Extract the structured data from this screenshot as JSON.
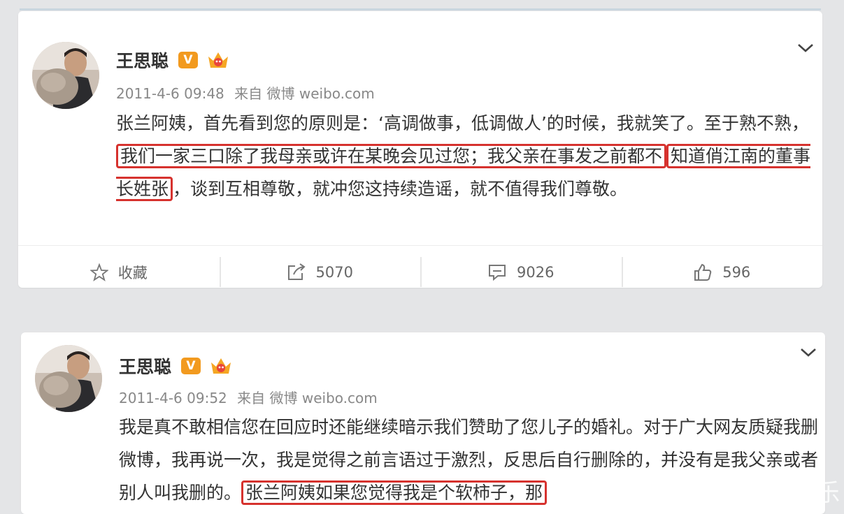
{
  "posts": [
    {
      "name": "王思聪",
      "v_badge": "V",
      "time": "2011-4-6 09:48",
      "source": "来自 微博 weibo.com",
      "text_parts": [
        "张兰阿姨，首先看到您的原则是：‘高调做事，低调做人’的时候，我就笑了。至于熟不熟，",
        "我们一家三口除了我母亲或许在某晚会见过您；我父亲在事发之前都不",
        "知道俏江南的董事长姓张",
        "，谈到互相尊敬，就冲您这持续造谣，就不值得我们尊敬。"
      ],
      "actions": {
        "favorite": "收藏",
        "repost": "5070",
        "comment": "9026",
        "like": "596"
      }
    },
    {
      "name": "王思聪",
      "v_badge": "V",
      "time": "2011-4-6 09:52",
      "source": "来自 微博 weibo.com",
      "text_parts": [
        "我是真不敢相信您在回应时还能继续暗示我们赞助了您儿子的婚礼。对于广大网友质疑我删微博，我再说一次，我是觉得之前言语过于激烈，反思后自行删除的，并没有是我父亲或者别人叫我删的。",
        "张兰阿姨如果您觉得我是个软柿子，那"
      ]
    }
  ],
  "watermark": "头条号 / 海潮娱乐"
}
